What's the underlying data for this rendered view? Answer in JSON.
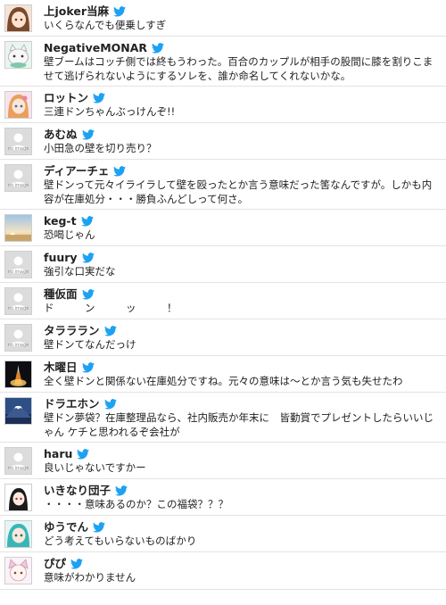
{
  "colors": {
    "bird": "#1da1f2",
    "divider": "#e3e3e3",
    "noimage_bg": "#dcdcdc"
  },
  "noimage_label": "no image",
  "tweets": [
    {
      "user": "上joker当麻",
      "text": "いくらなんでも便乗しすぎ",
      "avatar": "anime-girl-brown"
    },
    {
      "user": "NegativeMONAR",
      "text": "壁ブームはコッチ側では終もうわった。百合のカップルが相手の股間に膝を割りこませて逃げられないようにするソレを、誰か命名してくれないかな。",
      "avatar": "cat-character"
    },
    {
      "user": "ロットン",
      "text": "三連ドンちゃんぶっけんぞ!!",
      "avatar": "anime-girl-pink"
    },
    {
      "user": "あむぬ",
      "text": "小田急の壁を切り売り？",
      "avatar": "noimage"
    },
    {
      "user": "ディアーチェ",
      "text": "壁ドンって元々イライラして壁を殴ったとか言う意味だった筈なんですが。しかも内容が在庫処分・・・勝負ふんどしって何さ。",
      "avatar": "noimage"
    },
    {
      "user": "keg-t",
      "text": "恐喝じゃん",
      "avatar": "sunset-landscape"
    },
    {
      "user": "fuury",
      "text": "強引な口実だな",
      "avatar": "noimage"
    },
    {
      "user": "種仮面",
      "text": "ド　　　ン　　　ッ　　　！",
      "avatar": "noimage"
    },
    {
      "user": "タラララン",
      "text": "壁ドンてなんだっけ",
      "avatar": "noimage"
    },
    {
      "user": "木曜日",
      "text": "全く壁ドンと関係ない在庫処分ですね。元々の意味は～とか言う気も失せたわ",
      "avatar": "rocket-launch"
    },
    {
      "user": "ドラエホン",
      "text": "壁ドン夢袋？在庫整理品なら、社内販売か年末に　皆勤賞でプレゼントしたらいいじゃん ケチと思われるぞ会社が",
      "avatar": "mount-fuji"
    },
    {
      "user": "haru",
      "text": "良いじゃないですかー",
      "avatar": "noimage"
    },
    {
      "user": "いきなり団子",
      "text": "・・・・意味あるのか？この福袋？？？",
      "avatar": "anime-dark-hair"
    },
    {
      "user": "ゆうでん",
      "text": "どう考えてもいらないものばかり",
      "avatar": "anime-teal-hair"
    },
    {
      "user": "ぴぴ",
      "text": "意味がわかりません",
      "avatar": "cat-ears-girl"
    }
  ]
}
